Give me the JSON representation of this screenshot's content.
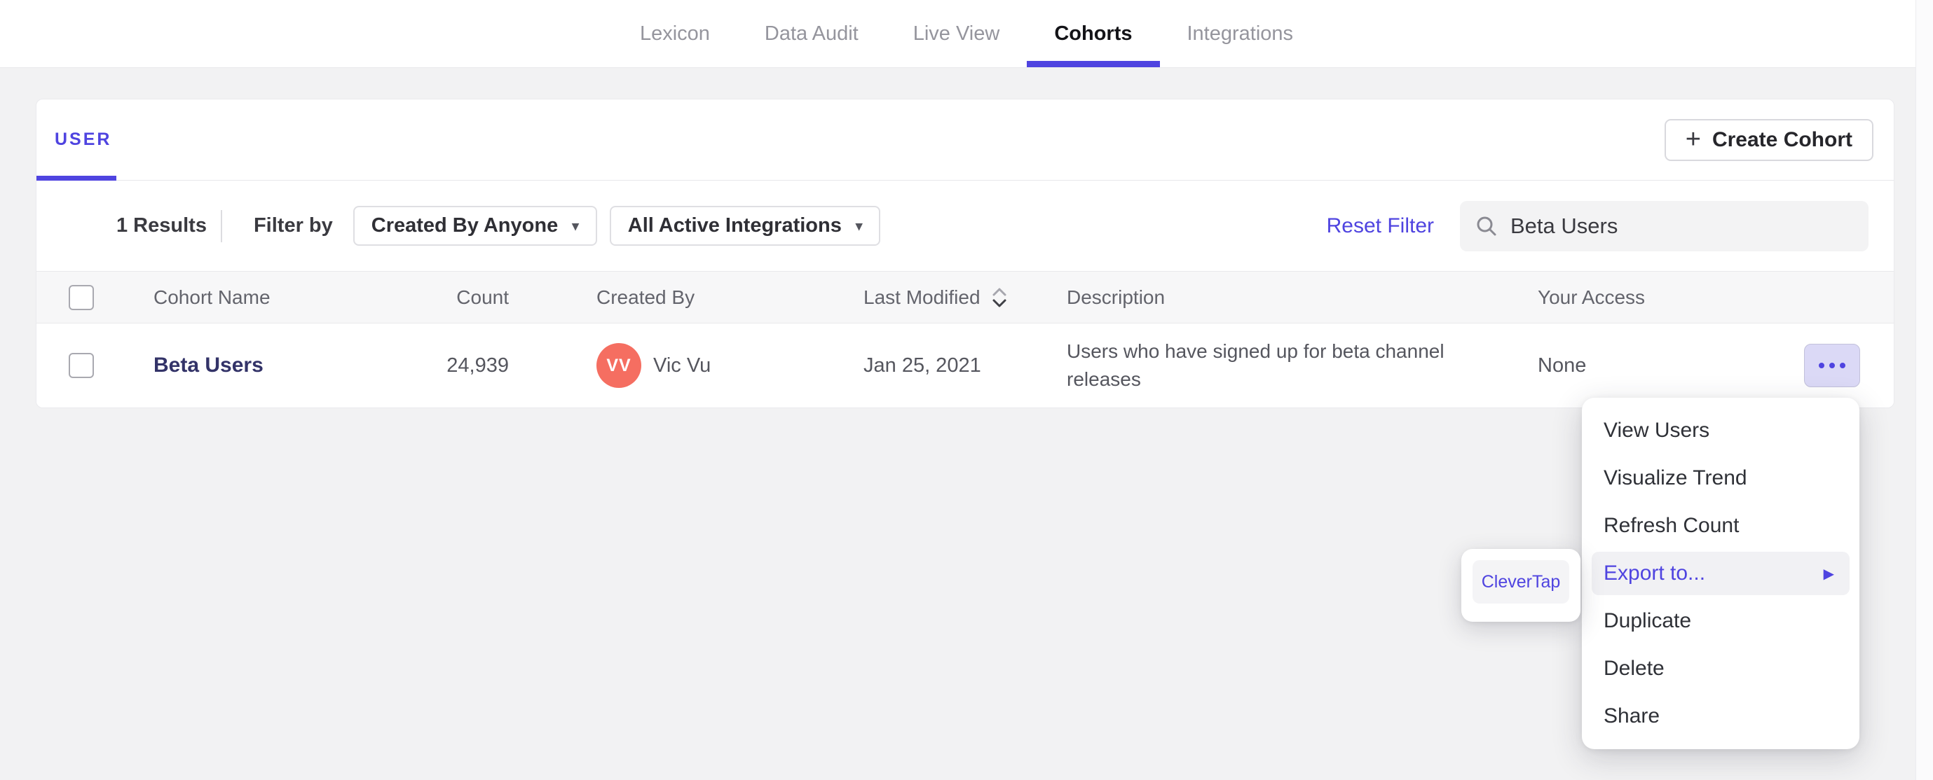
{
  "nav": {
    "items": [
      {
        "label": "Lexicon",
        "active": false
      },
      {
        "label": "Data Audit",
        "active": false
      },
      {
        "label": "Live View",
        "active": false
      },
      {
        "label": "Cohorts",
        "active": true
      },
      {
        "label": "Integrations",
        "active": false
      }
    ]
  },
  "panel": {
    "user_tab_label": "USER",
    "create_cohort_label": "Create Cohort",
    "filter": {
      "results_count": "1 Results",
      "filter_by_label": "Filter by",
      "created_by_dropdown": "Created By Anyone",
      "integrations_dropdown": "All Active Integrations",
      "reset_filter_label": "Reset Filter",
      "search_value": "Beta Users"
    },
    "table": {
      "headers": {
        "name": "Cohort Name",
        "count": "Count",
        "created_by": "Created By",
        "last_modified": "Last Modified",
        "description": "Description",
        "access": "Your Access"
      },
      "row": {
        "name": "Beta Users",
        "count": "24,939",
        "avatar_initials": "VV",
        "created_by": "Vic Vu",
        "last_modified": "Jan 25, 2021",
        "description": "Users who have signed up for beta channel releases",
        "access": "None"
      }
    }
  },
  "context_menu": {
    "items": [
      {
        "label": "View Users"
      },
      {
        "label": "Visualize Trend"
      },
      {
        "label": "Refresh Count"
      },
      {
        "label": "Export to...",
        "highlighted": true
      },
      {
        "label": "Duplicate"
      },
      {
        "label": "Delete"
      },
      {
        "label": "Share"
      }
    ]
  },
  "export_submenu": {
    "items": [
      {
        "label": "CleverTap"
      }
    ]
  },
  "icons": {
    "plus": "+",
    "caret_down": "▾",
    "submenu_arrow": "▶"
  },
  "colors": {
    "accent_purple": "#4f44e0",
    "page_background": "#f2f2f3",
    "table_header_background": "#f7f7f8",
    "cohort_link_navy": "#333368",
    "avatar_coral": "#f56e61",
    "row_menu_button_background": "#dbd9f6",
    "menu_highlight": "#f1f1f4"
  }
}
